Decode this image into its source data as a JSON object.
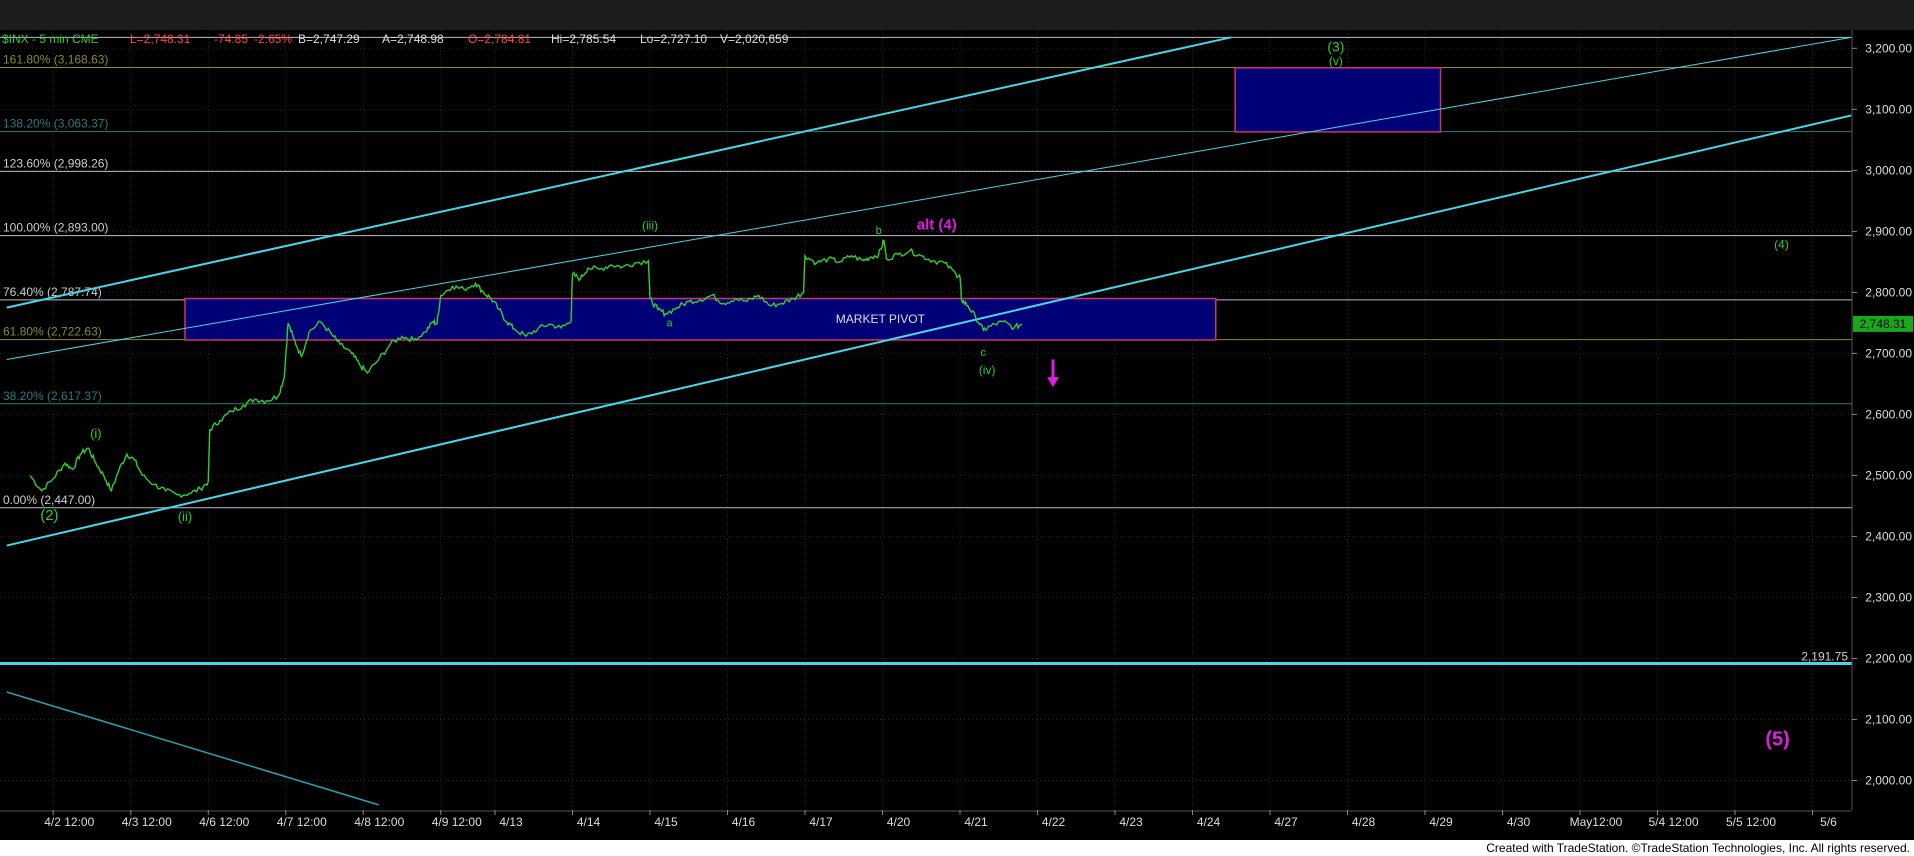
{
  "header": {
    "symbol": "$INX - 5 min  CME",
    "last": "L=2,748.31",
    "change": "-74.85",
    "change_pct": "-2.65%",
    "bid": "B=2,747.29",
    "ask": "A=2,748.98",
    "open": "O=2,784.81",
    "high": "Hi=2,785.54",
    "low": "Lo=2,727.10",
    "volume": "V=2,020,659"
  },
  "footer": {
    "credit": "Created with TradeStation. ©TradeStation Technologies, Inc. All rights reserved."
  },
  "colors": {
    "price": "#33cc33",
    "channel": "#44d8e8",
    "fib_olive": "#8a8a2a",
    "fib_teal": "#2e7a7a",
    "fib_white": "#bbbbcc",
    "box_fill": "#000080",
    "box_border": "#cc3366",
    "magenta": "#e01ee0",
    "axis_text": "#dddddd",
    "last_price_tag": "#18a818"
  },
  "chart_data": {
    "type": "line",
    "title": "",
    "ylim": [
      1950,
      3230
    ],
    "y_ticks": [
      {
        "v": 3200,
        "label": "3,200.00"
      },
      {
        "v": 3100,
        "label": "3,100.00"
      },
      {
        "v": 3000,
        "label": "3,000.00"
      },
      {
        "v": 2900,
        "label": "2,900.00"
      },
      {
        "v": 2800,
        "label": "2,800.00"
      },
      {
        "v": 2700,
        "label": "2,700.00"
      },
      {
        "v": 2600,
        "label": "2,600.00"
      },
      {
        "v": 2500,
        "label": "2,500.00"
      },
      {
        "v": 2400,
        "label": "2,400.00"
      },
      {
        "v": 2300,
        "label": "2,300.00"
      },
      {
        "v": 2200,
        "label": "2,200.00"
      },
      {
        "v": 2100,
        "label": "2,100.00"
      },
      {
        "v": 2000,
        "label": "2,000.00"
      }
    ],
    "x_ticks": [
      {
        "x": 0.3,
        "label": "4/2 12:00"
      },
      {
        "x": 1.3,
        "label": "4/3 12:00"
      },
      {
        "x": 2.3,
        "label": "4/6 12:00"
      },
      {
        "x": 3.3,
        "label": "4/7 12:00"
      },
      {
        "x": 4.3,
        "label": "4/8 12:00"
      },
      {
        "x": 5.3,
        "label": "4/9 12:00"
      },
      {
        "x": 6.0,
        "label": "4/13"
      },
      {
        "x": 7.0,
        "label": "4/14"
      },
      {
        "x": 8.0,
        "label": "4/15"
      },
      {
        "x": 9.0,
        "label": "4/16"
      },
      {
        "x": 10.0,
        "label": "4/17"
      },
      {
        "x": 11.0,
        "label": "4/20"
      },
      {
        "x": 12.0,
        "label": "4/21"
      },
      {
        "x": 13.0,
        "label": "4/22"
      },
      {
        "x": 14.0,
        "label": "4/23"
      },
      {
        "x": 15.0,
        "label": "4/24"
      },
      {
        "x": 16.0,
        "label": "4/27"
      },
      {
        "x": 17.0,
        "label": "4/28"
      },
      {
        "x": 18.0,
        "label": "4/29"
      },
      {
        "x": 19.0,
        "label": "4/30"
      },
      {
        "x": 20.0,
        "label": "May12:00"
      },
      {
        "x": 21.0,
        "label": "5/4 12:00"
      },
      {
        "x": 22.0,
        "label": "5/5 12:00"
      },
      {
        "x": 23.0,
        "label": "5/6"
      }
    ],
    "price_series": {
      "name": "$INX",
      "points": [
        [
          0.0,
          2500
        ],
        [
          0.15,
          2475
        ],
        [
          0.3,
          2495
        ],
        [
          0.45,
          2520
        ],
        [
          0.55,
          2510
        ],
        [
          0.65,
          2535
        ],
        [
          0.75,
          2545
        ],
        [
          0.85,
          2520
        ],
        [
          0.95,
          2500
        ],
        [
          1.05,
          2475
        ],
        [
          1.15,
          2510
        ],
        [
          1.25,
          2535
        ],
        [
          1.35,
          2525
        ],
        [
          1.45,
          2500
        ],
        [
          1.6,
          2485
        ],
        [
          1.75,
          2475
        ],
        [
          1.9,
          2468
        ],
        [
          2.05,
          2470
        ],
        [
          2.2,
          2478
        ],
        [
          2.3,
          2490
        ],
        [
          2.32,
          2575
        ],
        [
          2.45,
          2590
        ],
        [
          2.6,
          2605
        ],
        [
          2.75,
          2615
        ],
        [
          2.9,
          2625
        ],
        [
          3.05,
          2622
        ],
        [
          3.2,
          2630
        ],
        [
          3.28,
          2660
        ],
        [
          3.33,
          2750
        ],
        [
          3.4,
          2725
        ],
        [
          3.5,
          2695
        ],
        [
          3.6,
          2735
        ],
        [
          3.75,
          2752
        ],
        [
          3.9,
          2730
        ],
        [
          4.0,
          2715
        ],
        [
          4.15,
          2700
        ],
        [
          4.25,
          2682
        ],
        [
          4.35,
          2668
        ],
        [
          4.5,
          2690
        ],
        [
          4.65,
          2715
        ],
        [
          4.8,
          2728
        ],
        [
          4.95,
          2722
        ],
        [
          5.1,
          2735
        ],
        [
          5.2,
          2752
        ],
        [
          5.25,
          2748
        ],
        [
          5.3,
          2795
        ],
        [
          5.45,
          2810
        ],
        [
          5.6,
          2805
        ],
        [
          5.75,
          2815
        ],
        [
          5.85,
          2800
        ],
        [
          5.95,
          2790
        ],
        [
          6.05,
          2772
        ],
        [
          6.15,
          2752
        ],
        [
          6.25,
          2740
        ],
        [
          6.4,
          2728
        ],
        [
          6.55,
          2740
        ],
        [
          6.7,
          2748
        ],
        [
          6.85,
          2742
        ],
        [
          6.98,
          2752
        ],
        [
          7.0,
          2830
        ],
        [
          7.1,
          2822
        ],
        [
          7.2,
          2840
        ],
        [
          7.35,
          2838
        ],
        [
          7.5,
          2845
        ],
        [
          7.65,
          2842
        ],
        [
          7.8,
          2848
        ],
        [
          7.98,
          2852
        ],
        [
          8.0,
          2790
        ],
        [
          8.1,
          2772
        ],
        [
          8.2,
          2765
        ],
        [
          8.35,
          2775
        ],
        [
          8.5,
          2785
        ],
        [
          8.65,
          2788
        ],
        [
          8.8,
          2795
        ],
        [
          8.95,
          2782
        ],
        [
          9.1,
          2790
        ],
        [
          9.25,
          2785
        ],
        [
          9.4,
          2795
        ],
        [
          9.55,
          2778
        ],
        [
          9.7,
          2782
        ],
        [
          9.85,
          2790
        ],
        [
          9.98,
          2800
        ],
        [
          10.0,
          2860
        ],
        [
          10.15,
          2848
        ],
        [
          10.3,
          2855
        ],
        [
          10.45,
          2850
        ],
        [
          10.6,
          2860
        ],
        [
          10.75,
          2852
        ],
        [
          10.85,
          2858
        ],
        [
          10.95,
          2862
        ],
        [
          11.02,
          2885
        ],
        [
          11.05,
          2855
        ],
        [
          11.2,
          2862
        ],
        [
          11.35,
          2868
        ],
        [
          11.5,
          2860
        ],
        [
          11.65,
          2852
        ],
        [
          11.8,
          2848
        ],
        [
          11.95,
          2830
        ],
        [
          12.0,
          2825
        ],
        [
          12.02,
          2788
        ],
        [
          12.1,
          2778
        ],
        [
          12.2,
          2760
        ],
        [
          12.3,
          2738
        ],
        [
          12.4,
          2745
        ],
        [
          12.55,
          2752
        ],
        [
          12.7,
          2742
        ],
        [
          12.8,
          2748
        ]
      ]
    },
    "fib_levels": [
      {
        "v": 3168.63,
        "label": "161.80% (3,168.63)",
        "style": "olive"
      },
      {
        "v": 3063.37,
        "label": "138.20% (3,063.37)",
        "style": "teal"
      },
      {
        "v": 2998.26,
        "label": "123.60% (2,998.26)",
        "style": "white"
      },
      {
        "v": 2893.0,
        "label": "100.00% (2,893.00)",
        "style": "white"
      },
      {
        "v": 2787.74,
        "label": "76.40% (2,787.74)",
        "style": "white"
      },
      {
        "v": 2722.63,
        "label": "61.80% (2,722.63)",
        "style": "olive"
      },
      {
        "v": 2617.37,
        "label": "38.20% (2,617.37)",
        "style": "teal"
      },
      {
        "v": 2447.0,
        "label": "0.00% (2,447.00)",
        "style": "white"
      },
      {
        "v": 3218,
        "label": "",
        "style": "white"
      }
    ],
    "horizontal_line": {
      "v": 2191.75,
      "label": "2,191.75"
    },
    "channel_lines": [
      {
        "x1": -0.3,
        "y1": 2775,
        "x2": 15.5,
        "y2": 3218
      },
      {
        "x1": -0.3,
        "y1": 2690,
        "x2": 23.5,
        "y2": 3218
      },
      {
        "x1": -0.3,
        "y1": 2385,
        "x2": 23.5,
        "y2": 3090
      }
    ],
    "lower_line": {
      "x1": -0.3,
      "y1": 2145,
      "x2": 4.5,
      "y2": 1960
    },
    "zones": [
      {
        "x1": 2.0,
        "x2": 15.3,
        "y1": 2722,
        "y2": 2790,
        "label": "MARKET PIVOT"
      },
      {
        "x1": 15.55,
        "x2": 18.2,
        "y1": 3063,
        "y2": 3168,
        "label": ""
      }
    ],
    "wave_labels": [
      {
        "x": 0.25,
        "y": 2427,
        "text": "(2)",
        "color": "green",
        "size": 15
      },
      {
        "x": 0.85,
        "y": 2561,
        "text": "(i)",
        "color": "green",
        "size": 13
      },
      {
        "x": 2.0,
        "y": 2425,
        "text": "(ii)",
        "color": "green",
        "size": 13
      },
      {
        "x": 8.0,
        "y": 2903,
        "text": "(iii)",
        "color": "green",
        "size": 12
      },
      {
        "x": 8.25,
        "y": 2744,
        "text": "a",
        "color": "green",
        "size": 11
      },
      {
        "x": 10.95,
        "y": 2896,
        "text": "b",
        "color": "green",
        "size": 11
      },
      {
        "x": 12.3,
        "y": 2696,
        "text": "c",
        "color": "green",
        "size": 11
      },
      {
        "x": 12.35,
        "y": 2666,
        "text": "(iv)",
        "color": "green",
        "size": 12
      },
      {
        "x": 16.85,
        "y": 3195,
        "text": "(3)",
        "color": "green",
        "size": 14
      },
      {
        "x": 16.85,
        "y": 3173,
        "text": "(v)",
        "color": "green",
        "size": 12
      },
      {
        "x": 22.6,
        "y": 2872,
        "text": "(4)",
        "color": "green",
        "size": 12
      },
      {
        "x": 11.7,
        "y": 2903,
        "text": "alt (4)",
        "color": "magenta",
        "size": 15
      },
      {
        "x": 22.55,
        "y": 2057,
        "text": "(5)",
        "color": "magenta",
        "size": 20
      }
    ],
    "arrow": {
      "x": 13.2,
      "y_from": 2690,
      "y_to": 2648
    },
    "last_price": {
      "v": 2748.31,
      "label": "2,748.31"
    }
  }
}
